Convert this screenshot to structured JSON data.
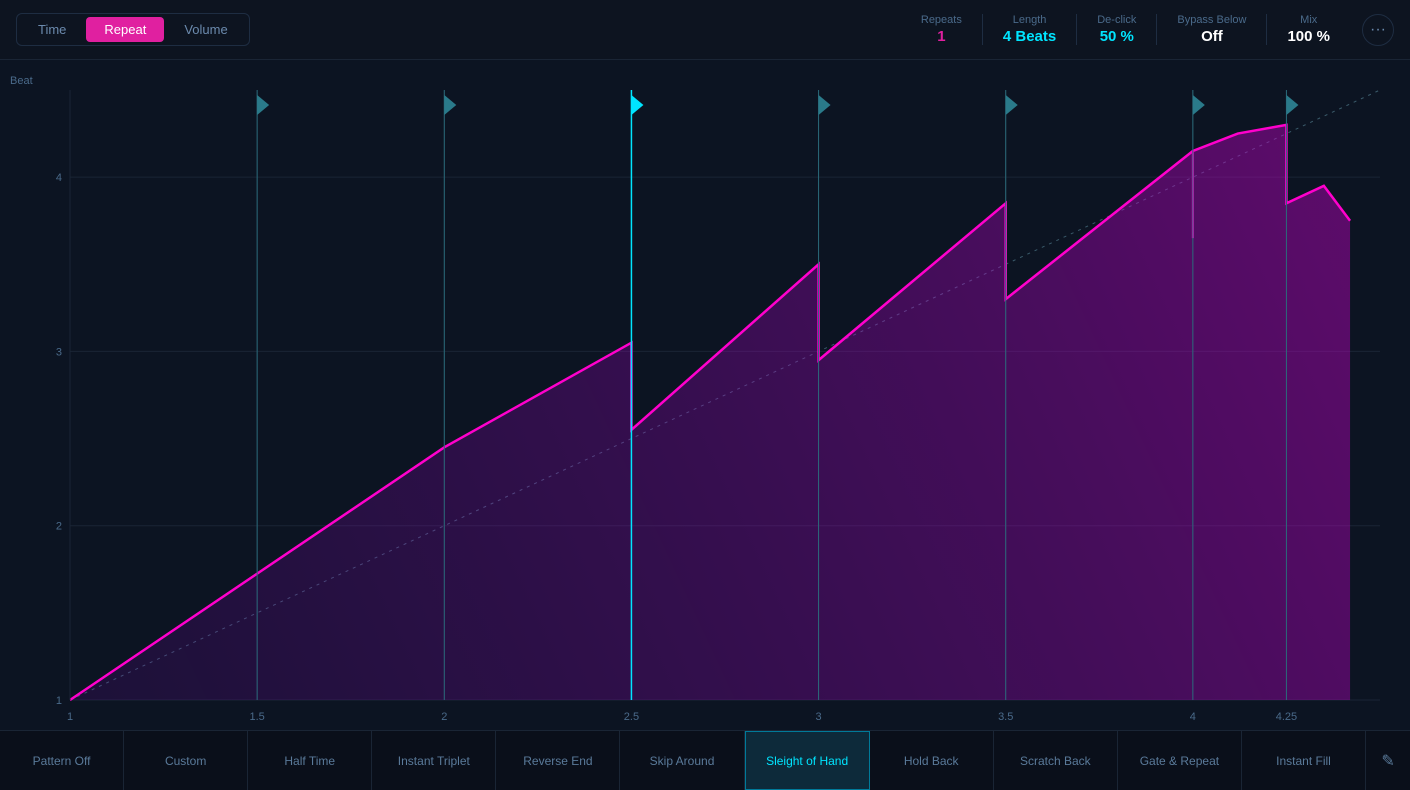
{
  "tabs": [
    {
      "label": "Time",
      "active": false
    },
    {
      "label": "Repeat",
      "active": true
    },
    {
      "label": "Volume",
      "active": false
    }
  ],
  "params": {
    "repeats_label": "Repeats",
    "repeats_value": "1",
    "length_label": "Length",
    "length_value": "4 Beats",
    "declick_label": "De-click",
    "declick_value": "50 %",
    "bypass_label": "Bypass Below",
    "bypass_value": "Off",
    "mix_label": "Mix",
    "mix_value": "100 %"
  },
  "chart": {
    "beat_label": "Beat",
    "x_ticks": [
      "1",
      "1.5",
      "2",
      "2.5",
      "3",
      "3.5",
      "4",
      "4.25"
    ],
    "y_ticks": [
      "1",
      "2",
      "3",
      "4"
    ]
  },
  "patterns": [
    {
      "label": "Pattern Off",
      "active": false
    },
    {
      "label": "Custom",
      "active": false
    },
    {
      "label": "Half Time",
      "active": false
    },
    {
      "label": "Instant Triplet",
      "active": false
    },
    {
      "label": "Reverse End",
      "active": false
    },
    {
      "label": "Skip Around",
      "active": false
    },
    {
      "label": "Sleight of Hand",
      "active": true
    },
    {
      "label": "Hold Back",
      "active": false
    },
    {
      "label": "Scratch Back",
      "active": false
    },
    {
      "label": "Gate & Repeat",
      "active": false
    },
    {
      "label": "Instant Fill",
      "active": false
    }
  ],
  "icons": {
    "more": "···",
    "edit": "✎"
  }
}
